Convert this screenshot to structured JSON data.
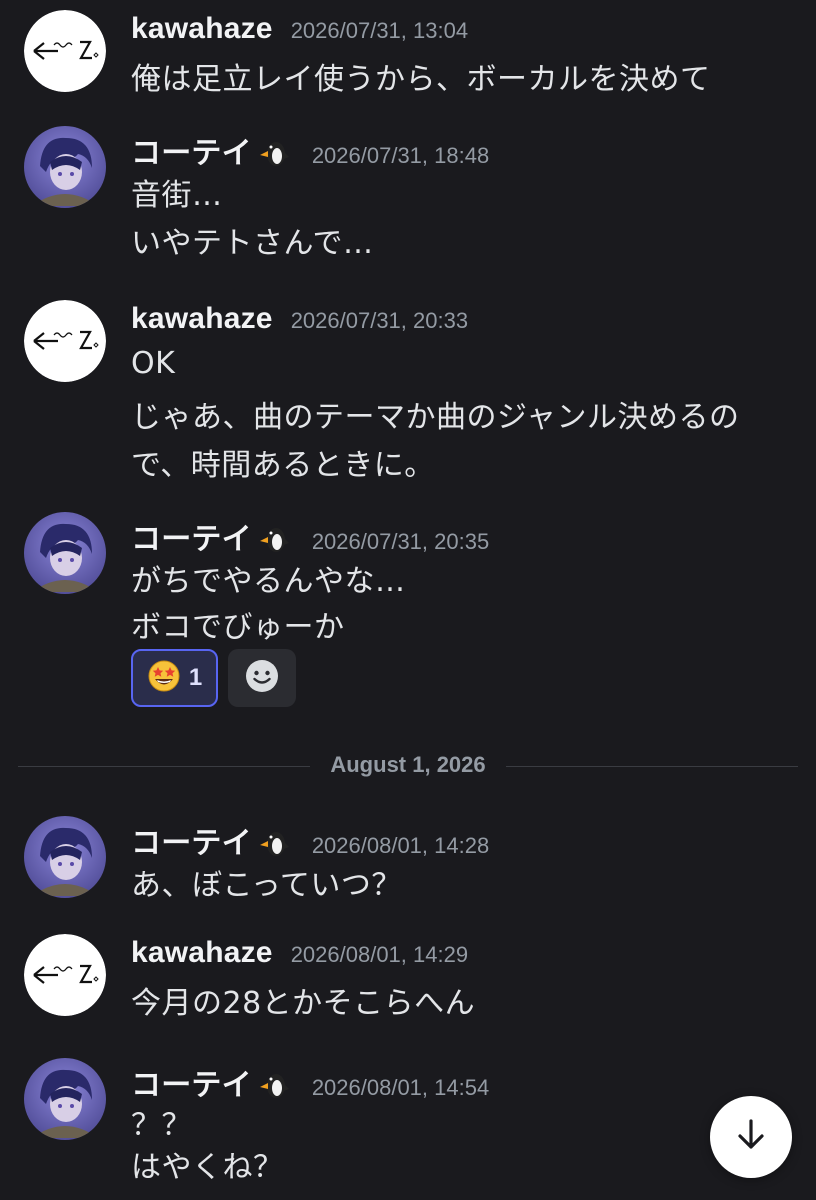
{
  "colors": {
    "background": "#1a1a1e",
    "username": "#f2f3f5",
    "timestamp": "#949ba4",
    "message_text": "#e3e5e8",
    "reaction_active_border": "#5865f2"
  },
  "messages": [
    {
      "username": "kawahaze",
      "avatar_icon": "kawahaze-avatar",
      "timestamp": "2026/07/31, 13:04",
      "lines": [
        "俺は足立レイ使うから、ボーカルを決めて"
      ]
    },
    {
      "username": "コーテイ",
      "avatar_icon": "koutei-avatar",
      "badge_icon": "penguin-icon",
      "timestamp": "2026/07/31, 18:48",
      "lines": [
        "音街…",
        "いやテトさんで…"
      ]
    },
    {
      "username": "kawahaze",
      "avatar_icon": "kawahaze-avatar",
      "timestamp": "2026/07/31, 20:33",
      "lines": [
        "OK",
        "じゃあ、曲のテーマか曲のジャンル決めるの",
        "で、時間あるときに。"
      ]
    },
    {
      "username": "コーテイ",
      "avatar_icon": "koutei-avatar",
      "badge_icon": "penguin-icon",
      "timestamp": "2026/07/31, 20:35",
      "lines": [
        "がちでやるんやな…",
        "ボコでびゅーか"
      ],
      "reactions": [
        {
          "icon": "star-struck-emoji-icon",
          "count": "1",
          "active": true
        }
      ],
      "add_reaction_icon": "add-reaction-smiley-icon"
    },
    {
      "username": "コーテイ",
      "avatar_icon": "koutei-avatar",
      "badge_icon": "penguin-icon",
      "timestamp": "2026/08/01, 14:28",
      "lines": [
        "あ、ぼこっていつ？"
      ]
    },
    {
      "username": "kawahaze",
      "avatar_icon": "kawahaze-avatar",
      "timestamp": "2026/08/01, 14:29",
      "lines": [
        "今月の28とかそこらへん"
      ]
    },
    {
      "username": "コーテイ",
      "avatar_icon": "koutei-avatar",
      "badge_icon": "penguin-icon",
      "timestamp": "2026/08/01, 14:54",
      "lines": [
        "？？",
        "はやくね？"
      ]
    }
  ],
  "date_divider": "August 1, 2026",
  "jump_to_present_icon": "arrow-down-icon"
}
